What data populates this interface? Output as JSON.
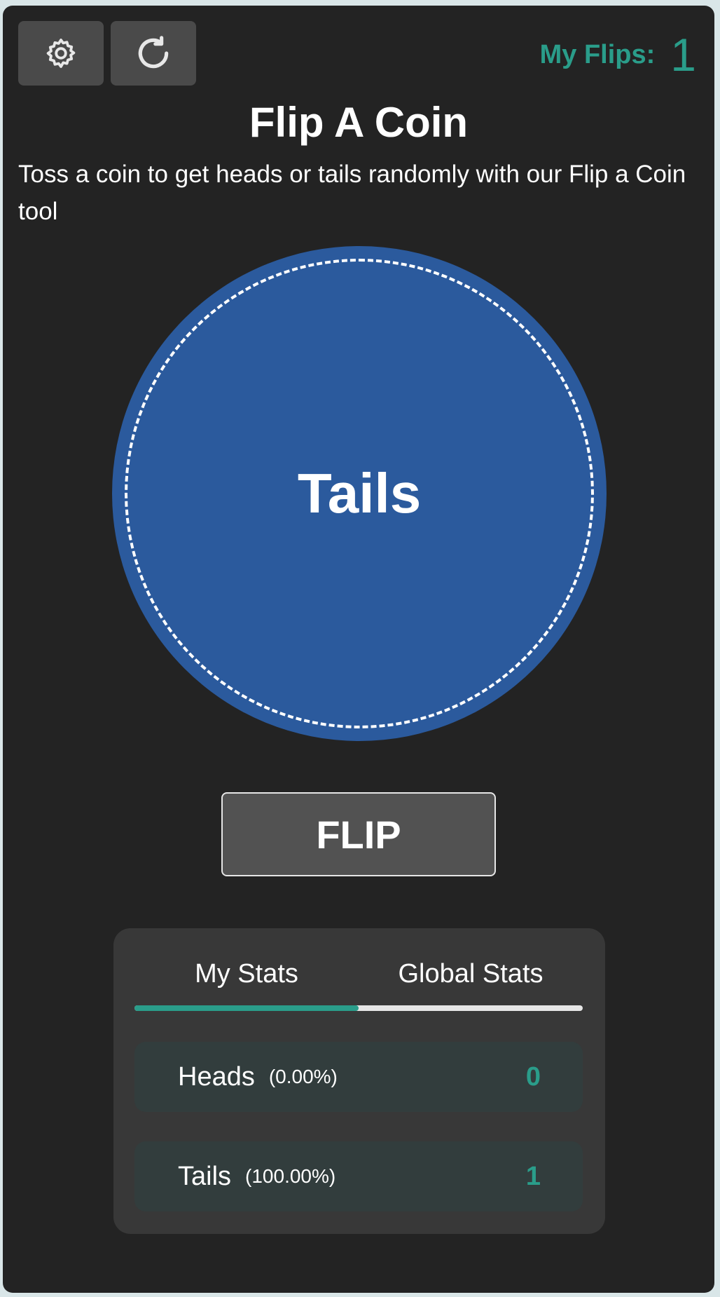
{
  "header": {
    "settings_icon": "gear-icon",
    "reset_icon": "refresh-icon",
    "flips_label": "My Flips:",
    "flips_count": "1"
  },
  "main": {
    "title": "Flip A Coin",
    "subtitle": "Toss a coin to get heads or tails randomly with our Flip a Coin tool",
    "coin_result": "Tails",
    "flip_label": "FLIP"
  },
  "stats": {
    "tabs": [
      {
        "label": "My Stats",
        "active": true
      },
      {
        "label": "Global Stats",
        "active": false
      }
    ],
    "rows": [
      {
        "name": "Heads",
        "percent": "(0.00%)",
        "count": "0"
      },
      {
        "name": "Tails",
        "percent": "(100.00%)",
        "count": "1"
      }
    ]
  },
  "colors": {
    "accent": "#2a9d8a",
    "coin": "#2b5a9d",
    "panel": "#232323",
    "card": "#383838"
  }
}
